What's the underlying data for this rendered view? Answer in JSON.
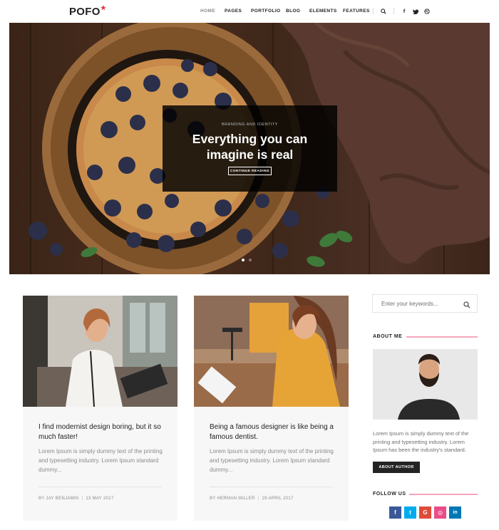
{
  "header": {
    "logo": "POFO",
    "logo_mark": "*",
    "nav": [
      "HOME",
      "PAGES",
      "PORTFOLIO",
      "BLOG",
      "ELEMENTS",
      "FEATURES"
    ],
    "active_nav": "HOME",
    "icons": [
      "search-icon",
      "facebook-icon",
      "twitter-icon",
      "dribbble-icon"
    ]
  },
  "hero": {
    "kicker": "BRANDING AND IDENTITY",
    "title_line1": "Everything you can",
    "title_line2": "imagine is real",
    "button": "CONTINUE READING",
    "slides": 2,
    "active_slide": 1
  },
  "posts": [
    {
      "title": "I find modernist design boring, but it so much faster!",
      "excerpt": "Lorem Ipsum is simply dummy text of the printing and typesetting industry. Lorem Ipsum standard dummy...",
      "author": "BY JAY BENJAMIN",
      "date": "13 MAY 2017"
    },
    {
      "title": "Being a famous designer is like being a famous dentist.",
      "excerpt": "Lorem Ipsum is simply dummy text of the printing and typesetting industry. Lorem Ipsum standard dummy...",
      "author": "BY HERMAN MILLER",
      "date": "29 APRIL 2017"
    }
  ],
  "sidebar": {
    "search_placeholder": "Enter your keywords...",
    "about_heading": "ABOUT ME",
    "about_text": "Lorem Ipsum is simply dummy text of the printing and typesetting industry. Lorem Ipsum has been the industry's standard.",
    "about_button": "ABOUT AUTHOR",
    "follow_heading": "FOLLOW US",
    "social": [
      {
        "icon": "facebook-icon",
        "glyph": "f",
        "color": "#3b5998"
      },
      {
        "icon": "twitter-icon",
        "glyph": "t",
        "color": "#00aced"
      },
      {
        "icon": "google-plus-icon",
        "glyph": "G",
        "color": "#dd4b39"
      },
      {
        "icon": "dribbble-icon",
        "glyph": "◎",
        "color": "#ea4c89"
      },
      {
        "icon": "linkedin-icon",
        "glyph": "in",
        "color": "#0077b5"
      }
    ]
  },
  "colors": {
    "accent": "#e42a3a",
    "rule_pink": "#f5a6bb",
    "card_bg": "#f7f7f7",
    "dark": "#232323"
  }
}
